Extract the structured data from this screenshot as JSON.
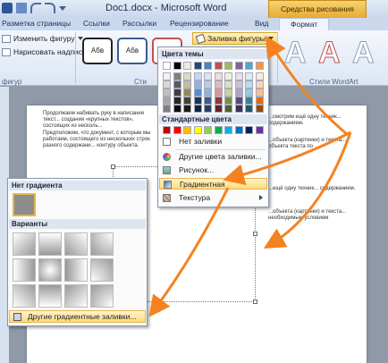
{
  "titlebar": {
    "title": "Doc1.docx - Microsoft Word",
    "context_tab": "Средства рисования"
  },
  "tabs": [
    "Разметка страницы",
    "Ссылки",
    "Рассылки",
    "Рецензирование",
    "Вид",
    "Формат"
  ],
  "ribbon": {
    "change_shape": "Изменить фигуру",
    "draw_textbox": "Нарисовать надпись",
    "group_left_label": "фигур",
    "group_styles_label": "Сти",
    "group_wordart_label": "Стили WordArt",
    "style_sample": "Абв",
    "fill_button": "Заливка фигуры",
    "wordart_letter": "A"
  },
  "dropdown": {
    "theme_colors_header": "Цвета темы",
    "standard_colors_header": "Стандартные цвета",
    "no_fill": "Нет заливки",
    "other_colors": "Другие цвета заливки...",
    "picture": "Рисунок...",
    "gradient": "Градиентная",
    "texture": "Текстура",
    "theme_top_row": [
      "#ffffff",
      "#000000",
      "#eeece1",
      "#1f497d",
      "#4f81bd",
      "#c0504d",
      "#9bbb59",
      "#8064a2",
      "#4bacc6",
      "#f79646"
    ],
    "theme_shade_rows": [
      [
        "#f2f2f2",
        "#7f7f7f",
        "#ddd9c3",
        "#c6d9f0",
        "#dbe5f1",
        "#f2dcdb",
        "#ebf1dd",
        "#e5e0ec",
        "#dbeef3",
        "#fdeada"
      ],
      [
        "#d8d8d8",
        "#595959",
        "#c4bd97",
        "#8db3e2",
        "#b8cce4",
        "#e5b9b7",
        "#d7e3bc",
        "#ccc1d9",
        "#b7dde8",
        "#fbd5b5"
      ],
      [
        "#bfbfbf",
        "#3f3f3f",
        "#938953",
        "#548dd4",
        "#95b3d7",
        "#d99694",
        "#c3d69b",
        "#b2a2c7",
        "#92cddc",
        "#fac08f"
      ],
      [
        "#a5a5a5",
        "#262626",
        "#494429",
        "#17365d",
        "#366092",
        "#953734",
        "#76923c",
        "#5f497a",
        "#31859b",
        "#e36c09"
      ],
      [
        "#7f7f7f",
        "#0c0c0c",
        "#1d1b10",
        "#0f243e",
        "#244061",
        "#632423",
        "#4f6128",
        "#3f3151",
        "#205867",
        "#974806"
      ]
    ],
    "standard_row": [
      "#c00000",
      "#ff0000",
      "#ffc000",
      "#ffff00",
      "#92d050",
      "#00b050",
      "#00b0f0",
      "#0070c0",
      "#002060",
      "#7030a0"
    ]
  },
  "gradient_panel": {
    "no_gradient": "Нет градиента",
    "variants": "Варианты",
    "more": "Другие градиентные заливки..."
  },
  "document": {
    "para1": "Продолжаем набивать руку в написании текст... создания «крупных текстов», состоящих из несколь...",
    "para2": "Предположим, что документ, с которым мы работаем, состоящего из нескольких строк разного содержани... контуру объекта.",
    "right1": "...смотрим ещё одну техник... содержанием.",
    "right2": "...объекта (картинки) и текста... объекта текста по",
    "right3": "...ещё одну техник... содержанием.",
    "right4": "...объекта (картинки) и текста... необходимым условием"
  },
  "colors": {
    "accent_orange": "#f58220",
    "highlight": "#ffd97a"
  }
}
